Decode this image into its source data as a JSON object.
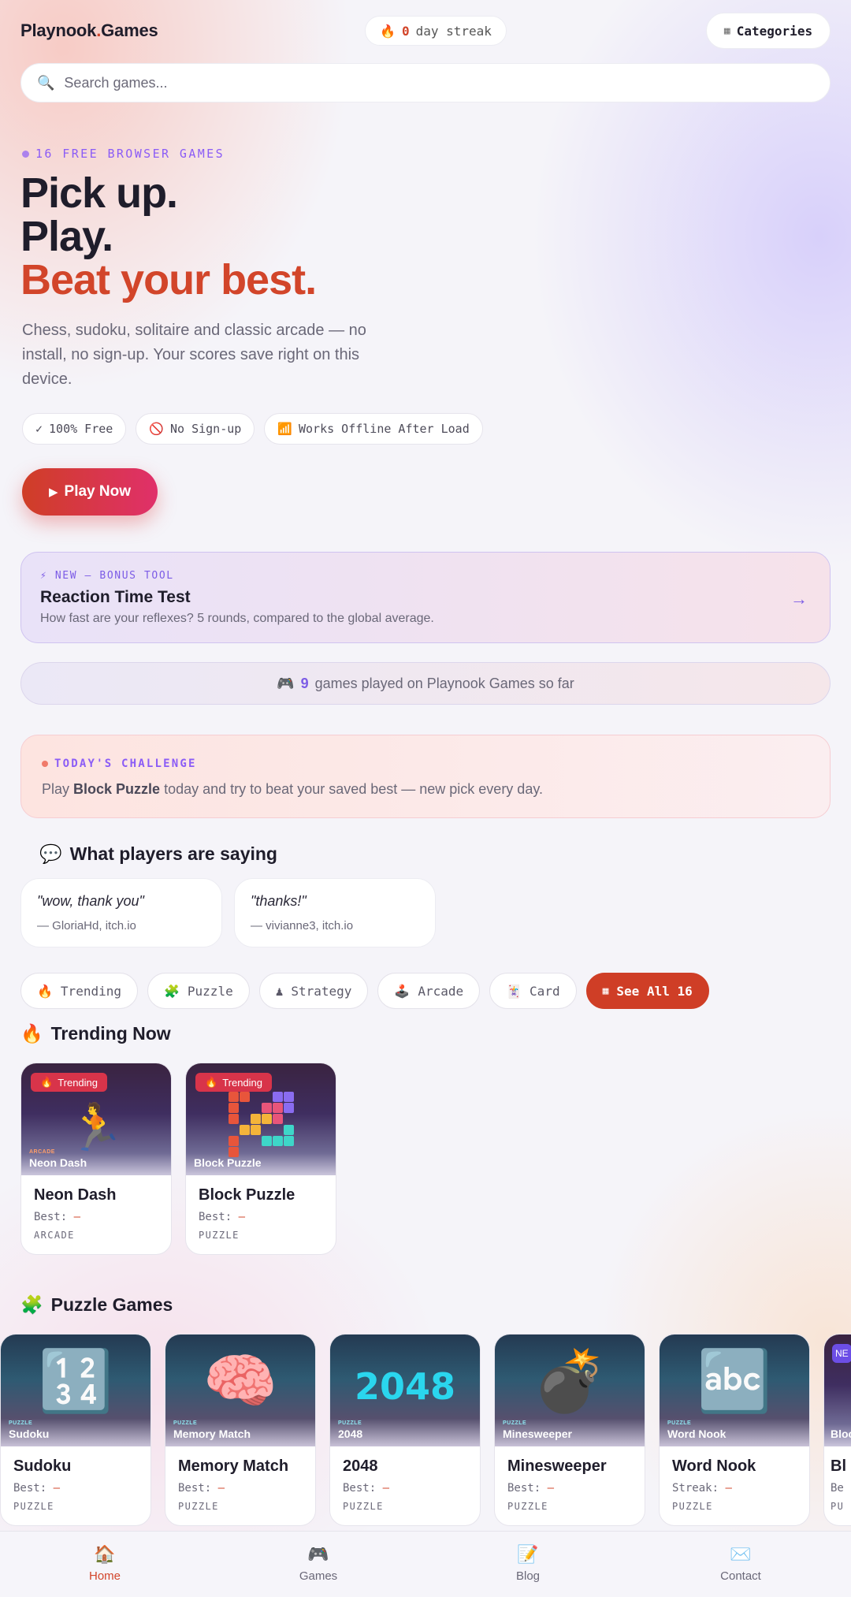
{
  "header": {
    "logo_main": "Playnook",
    "logo_dot": ".",
    "logo_tail": "Games",
    "streak_icon": "🔥",
    "streak_count": "0",
    "streak_label": "day streak",
    "categories_icon": "▦",
    "categories_label": "Categories"
  },
  "search": {
    "icon": "🔍",
    "placeholder": "Search games..."
  },
  "hero": {
    "eyebrow": "16 FREE BROWSER GAMES",
    "line1": "Pick up.",
    "line2": "Play.",
    "line3": "Beat your best.",
    "subtitle": "Chess, sudoku, solitaire and classic arcade — no install, no sign-up. Your scores save right on this device.",
    "pills": [
      {
        "icon": "✓",
        "label": "100% Free"
      },
      {
        "icon": "🚫",
        "label": "No Sign-up"
      },
      {
        "icon": "📶",
        "label": "Works Offline After Load"
      }
    ],
    "play_icon": "▶",
    "play_label": "Play Now"
  },
  "bonus": {
    "tag": "⚡ NEW — BONUS TOOL",
    "title": "Reaction Time Test",
    "description": "How fast are your reflexes? 5 rounds, compared to the global average.",
    "arrow": "→"
  },
  "played": {
    "icon": "🎮",
    "count": "9",
    "text": "games played on Playnook Games so far"
  },
  "challenge": {
    "tag": "TODAY'S CHALLENGE",
    "prefix": "Play",
    "game": "Block Puzzle",
    "suffix": "today and try to beat your saved best — new pick every day."
  },
  "testimonials": {
    "icon": "💬",
    "title": "What players are saying",
    "items": [
      {
        "quote": "\"wow, thank you\"",
        "author": "— GloriaHd, itch.io"
      },
      {
        "quote": "\"thanks!\"",
        "author": "— vivianne3, itch.io"
      }
    ]
  },
  "filters": [
    {
      "icon": "🔥",
      "label": "Trending"
    },
    {
      "icon": "🧩",
      "label": "Puzzle"
    },
    {
      "icon": "♟",
      "label": "Strategy"
    },
    {
      "icon": "🕹️",
      "label": "Arcade"
    },
    {
      "icon": "🃏",
      "label": "Card"
    },
    {
      "icon": "▦",
      "label": "See All 16"
    }
  ],
  "trending": {
    "icon": "🔥",
    "title": "Trending Now",
    "badge": "Trending",
    "cards": [
      {
        "thumb_category": "ARCADE",
        "thumb_name": "Neon Dash",
        "glyph": "🏃",
        "name": "Neon Dash",
        "best_label": "Best:",
        "best_value": "—",
        "category": "ARCADE"
      },
      {
        "thumb_name": "Block Puzzle",
        "name": "Block Puzzle",
        "best_label": "Best:",
        "best_value": "—",
        "category": "PUZZLE"
      }
    ]
  },
  "puzzle": {
    "icon": "🧩",
    "title": "Puzzle Games",
    "cards": [
      {
        "thumb_category": "PUZZLE",
        "thumb_name": "Sudoku",
        "glyph": "🔢",
        "name": "Sudoku",
        "best_label": "Best:",
        "best_value": "—",
        "category": "PUZZLE"
      },
      {
        "thumb_category": "PUZZLE",
        "thumb_name": "Memory Match",
        "glyph": "🧠",
        "name": "Memory Match",
        "best_label": "Best:",
        "best_value": "—",
        "category": "PUZZLE"
      },
      {
        "thumb_category": "PUZZLE",
        "thumb_name": "2048",
        "glyph": "2048",
        "name": "2048",
        "best_label": "Best:",
        "best_value": "—",
        "category": "PUZZLE"
      },
      {
        "thumb_category": "PUZZLE",
        "thumb_name": "Minesweeper",
        "glyph": "💣",
        "name": "Minesweeper",
        "best_label": "Best:",
        "best_value": "—",
        "category": "PUZZLE"
      },
      {
        "thumb_category": "PUZZLE",
        "thumb_name": "Word Nook",
        "glyph": "🔤",
        "name": "Word Nook",
        "best_label": "Streak:",
        "best_value": "—",
        "category": "PUZZLE"
      },
      {
        "thumb_name": "Bloc",
        "badge": "NE",
        "name": "Bl",
        "best_label": "Be",
        "category": "PU"
      }
    ]
  },
  "bottom_nav": [
    {
      "icon": "🏠",
      "label": "Home"
    },
    {
      "icon": "🎮",
      "label": "Games"
    },
    {
      "icon": "📝",
      "label": "Blog"
    },
    {
      "icon": "✉️",
      "label": "Contact"
    }
  ],
  "colors": {
    "accent": "#d2452a",
    "violet": "#8b5cf6",
    "badge": "#d8344a"
  }
}
